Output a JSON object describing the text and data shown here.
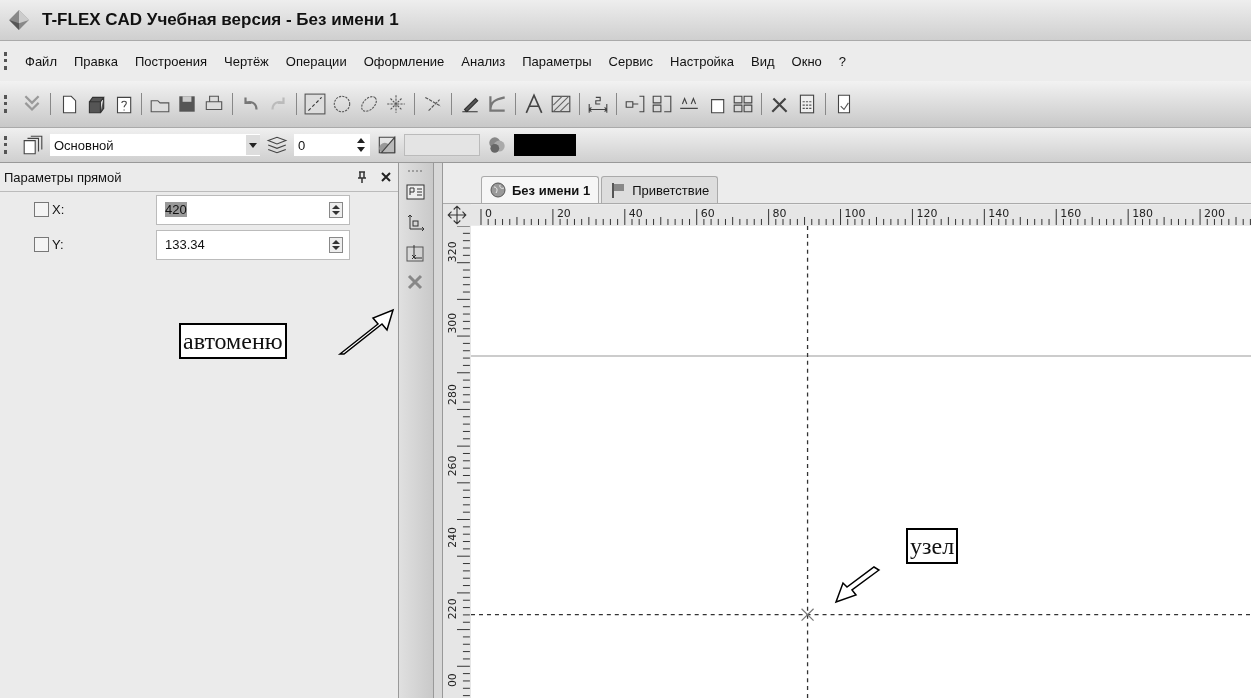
{
  "window": {
    "title": "T-FLEX CAD Учебная версия - Без имени 1"
  },
  "menu": [
    "Файл",
    "Правка",
    "Построения",
    "Чертёж",
    "Операции",
    "Оформление",
    "Анализ",
    "Параметры",
    "Сервис",
    "Настройка",
    "Вид",
    "Окно",
    "?"
  ],
  "layer_toolbar": {
    "layer": "Основной",
    "level_value": "0"
  },
  "parameters_panel": {
    "title": "Параметры прямой",
    "fields": [
      {
        "label": "X:",
        "checked": false,
        "value": "420",
        "text_selected": true
      },
      {
        "label": "Y:",
        "checked": false,
        "value": "133.34",
        "text_selected": false
      }
    ]
  },
  "document_tabs": [
    {
      "label": "Без имени 1",
      "selected": true
    },
    {
      "label": "Приветствие",
      "selected": false
    }
  ],
  "top_ruler": [
    "0",
    "20",
    "40",
    "60",
    "80",
    "100",
    "120",
    "140",
    "160",
    "180",
    "200"
  ],
  "left_ruler": [
    "320",
    "300",
    "280",
    "260",
    "240",
    "220",
    "00"
  ],
  "annotations": [
    {
      "kind": "automenu",
      "text": "автоменю"
    },
    {
      "kind": "node",
      "text": "узел"
    }
  ]
}
